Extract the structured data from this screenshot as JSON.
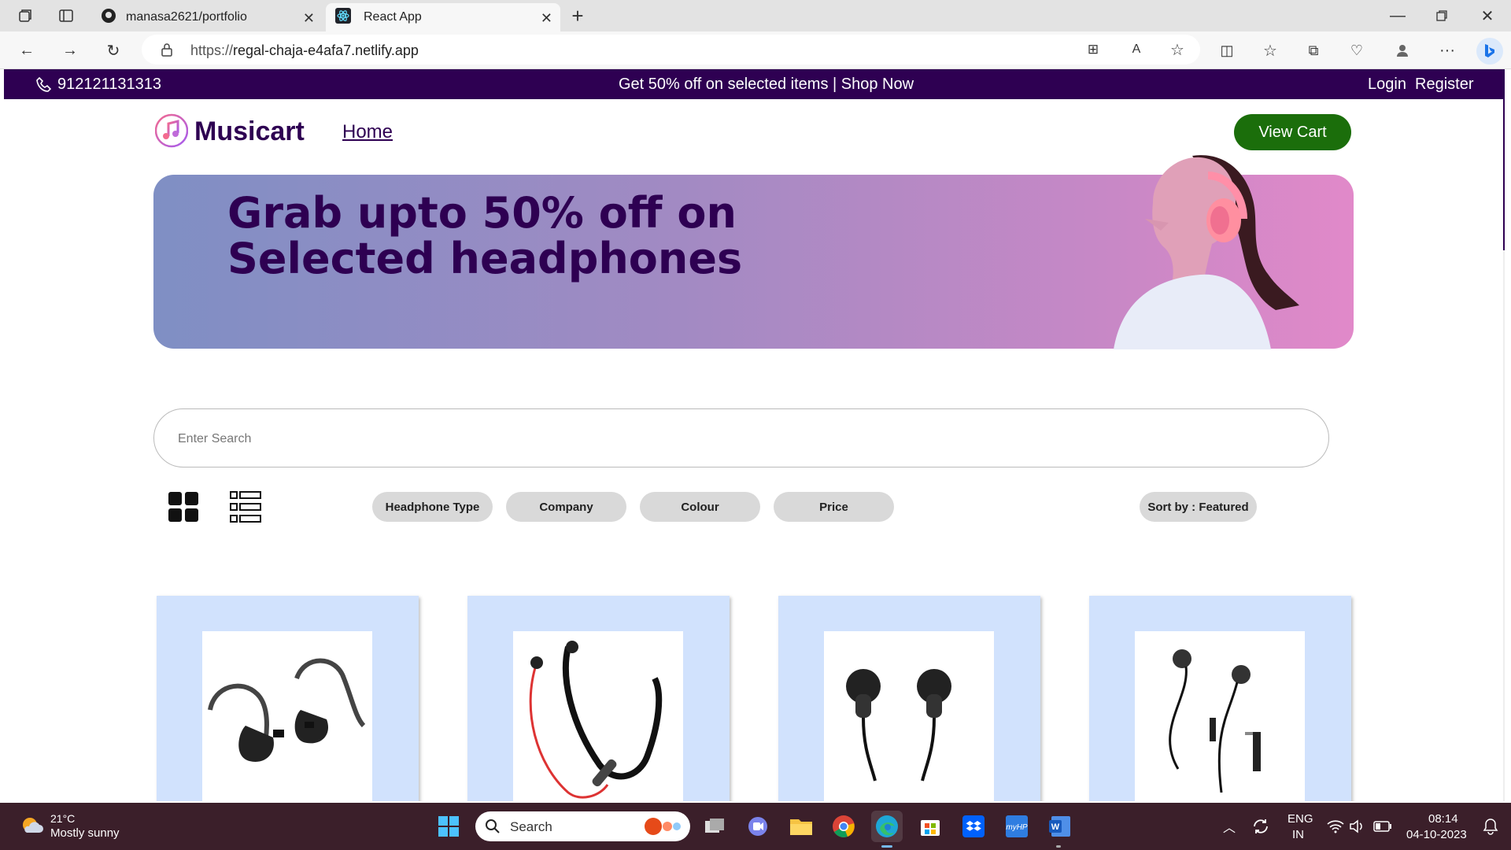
{
  "browser": {
    "tabs": [
      {
        "title": "manasa2621/portfolio",
        "active": false
      },
      {
        "title": "React App",
        "active": true
      }
    ],
    "url_prefix": "https://",
    "url_host": "regal-chaja-e4afa7.netlify.app"
  },
  "site": {
    "phone": "912121131313",
    "promo": "Get 50% off on selected items | Shop Now",
    "login": "Login",
    "register": "Register",
    "brand": "Musicart",
    "nav_home": "Home",
    "view_cart": "View Cart",
    "banner_line1": "Grab upto 50% off on",
    "banner_line2": "Selected headphones",
    "search_placeholder": "Enter Search",
    "filters": [
      "Headphone Type",
      "Company",
      "Colour",
      "Price"
    ],
    "sort_label": "Sort by : Featured"
  },
  "taskbar": {
    "weather_temp": "21°C",
    "weather_desc": "Mostly sunny",
    "search_label": "Search",
    "lang_top": "ENG",
    "lang_bottom": "IN",
    "time": "08:14",
    "date": "04-10-2023"
  },
  "colors": {
    "brand_purple": "#2e0052",
    "cart_green": "#1b6e0b",
    "card_bg": "#d1e2fd"
  }
}
